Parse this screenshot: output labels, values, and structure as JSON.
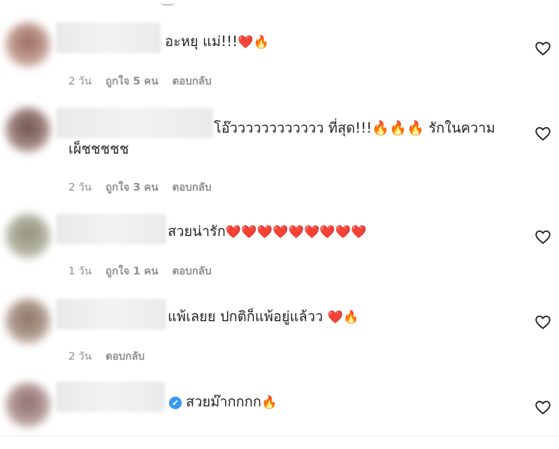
{
  "colors": {
    "text": "#262626",
    "meta": "#8e8e8e",
    "verified": "#3897f0",
    "emoji_heart": "#e0245e",
    "emoji_fire": "#ff8c1a"
  },
  "icons": {
    "like": "heart-outline-icon",
    "verified": "verified-badge-icon"
  },
  "comments": [
    {
      "text": "อะหยุ แม่!!!",
      "emoji": "❤️🔥",
      "time": "2 วัน",
      "likes": "ถูกใจ 5 คน",
      "reply": "ตอบกลับ"
    },
    {
      "text": "โอ๊วววววววววววว ที่สุด!!!🔥🔥🔥 รักในความ",
      "text2": "เผ็ชชชชช",
      "time": "2 วัน",
      "likes": "ถูกใจ 3 คน",
      "reply": "ตอบกลับ"
    },
    {
      "text": "สวยน่ารัก",
      "emoji": "❤️❤️❤️❤️❤️❤️❤️❤️❤️",
      "time": "1 วัน",
      "likes": "ถูกใจ 1 คน",
      "reply": "ตอบกลับ"
    },
    {
      "text": "แพ้เลยย ปกติก็แพ้อยู่แล้วว",
      "emoji": "❤️🔥",
      "time": "2 วัน",
      "reply": "ตอบกลับ"
    },
    {
      "text": "สวยม๊ากกกก",
      "emoji": "🔥",
      "verified": "✔"
    }
  ]
}
